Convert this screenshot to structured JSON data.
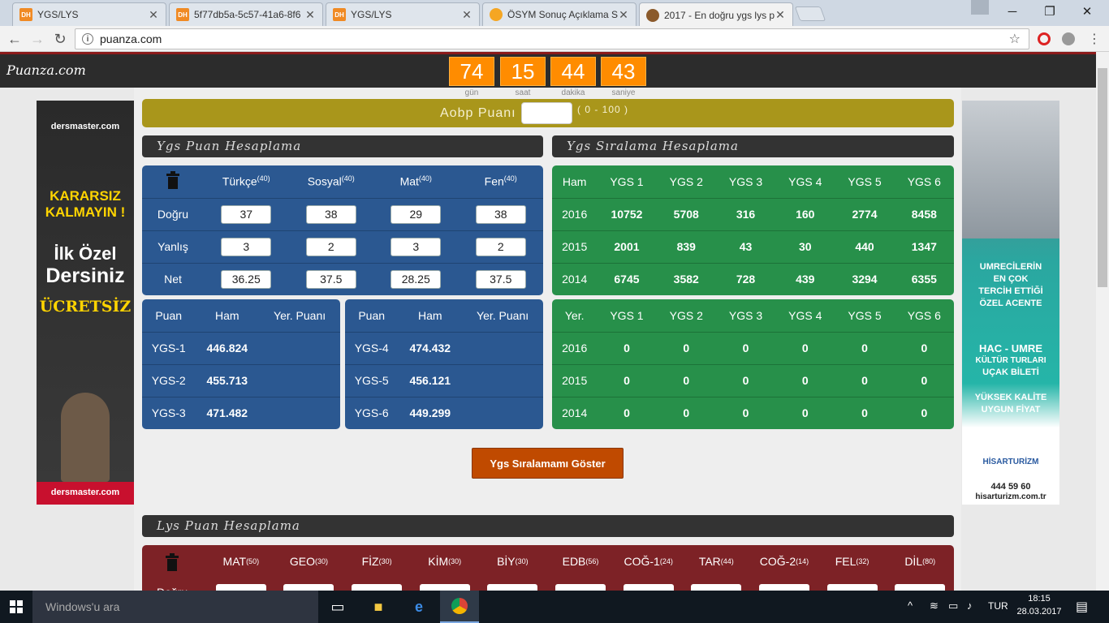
{
  "browser": {
    "tabs": [
      {
        "favicon": "DH",
        "title": "YGS/LYS",
        "color": "#f08a24"
      },
      {
        "favicon": "DH",
        "title": "5f77db5a-5c57-41a6-8f6",
        "color": "#f08a24"
      },
      {
        "favicon": "DH",
        "title": "YGS/LYS",
        "color": "#f08a24"
      },
      {
        "favicon": "",
        "title": "ÖSYM Sonuç Açıklama S",
        "color": "#f5a623"
      },
      {
        "favicon": "",
        "title": "2017 - En doğru ygs lys p",
        "color": "#8b5a2b"
      }
    ],
    "url": "puanza.com"
  },
  "site": {
    "logo": "Puanza.com",
    "countdown": [
      {
        "value": "74",
        "label": "gün"
      },
      {
        "value": "15",
        "label": "saat"
      },
      {
        "value": "44",
        "label": "dakika"
      },
      {
        "value": "43",
        "label": "saniye"
      }
    ],
    "aobp": {
      "label": "Aobp Puanı",
      "value": "",
      "range": "( 0 - 100 )"
    },
    "ygs_header": "Ygs Puan Hesaplama",
    "sira_header": "Ygs Sıralama Hesaplama",
    "lys_header": "Lys Puan Hesaplama",
    "subjects": [
      {
        "name": "Türkçe",
        "max": "(40)",
        "dogru": "37",
        "yanlis": "3",
        "net": "36.25"
      },
      {
        "name": "Sosyal",
        "max": "(40)",
        "dogru": "38",
        "yanlis": "2",
        "net": "37.5"
      },
      {
        "name": "Mat",
        "max": "(40)",
        "dogru": "29",
        "yanlis": "3",
        "net": "28.25"
      },
      {
        "name": "Fen",
        "max": "(40)",
        "dogru": "38",
        "yanlis": "2",
        "net": "37.5"
      }
    ],
    "row_labels": {
      "dogru": "Doğru",
      "yanlis": "Yanlış",
      "net": "Net"
    },
    "score_headers": {
      "puan": "Puan",
      "ham": "Ham",
      "yer": "Yer. Puanı"
    },
    "scores_left": [
      {
        "type": "YGS-1",
        "ham": "446.824",
        "yer": ""
      },
      {
        "type": "YGS-2",
        "ham": "455.713",
        "yer": ""
      },
      {
        "type": "YGS-3",
        "ham": "471.482",
        "yer": ""
      }
    ],
    "scores_right": [
      {
        "type": "YGS-4",
        "ham": "474.432",
        "yer": ""
      },
      {
        "type": "YGS-5",
        "ham": "456.121",
        "yer": ""
      },
      {
        "type": "YGS-6",
        "ham": "449.299",
        "yer": ""
      }
    ],
    "rank_ham": {
      "header": [
        "Ham",
        "YGS 1",
        "YGS 2",
        "YGS 3",
        "YGS 4",
        "YGS 5",
        "YGS 6"
      ],
      "rows": [
        [
          "2016",
          "10752",
          "5708",
          "316",
          "160",
          "2774",
          "8458"
        ],
        [
          "2015",
          "2001",
          "839",
          "43",
          "30",
          "440",
          "1347"
        ],
        [
          "2014",
          "6745",
          "3582",
          "728",
          "439",
          "3294",
          "6355"
        ]
      ]
    },
    "rank_yer": {
      "header": [
        "Yer.",
        "YGS 1",
        "YGS 2",
        "YGS 3",
        "YGS 4",
        "YGS 5",
        "YGS 6"
      ],
      "rows": [
        [
          "2016",
          "0",
          "0",
          "0",
          "0",
          "0",
          "0"
        ],
        [
          "2015",
          "0",
          "0",
          "0",
          "0",
          "0",
          "0"
        ],
        [
          "2014",
          "0",
          "0",
          "0",
          "0",
          "0",
          "0"
        ]
      ]
    },
    "rank_button": "Ygs Sıralamamı Göster",
    "lys_subjects": [
      {
        "name": "MAT",
        "max": "(50)"
      },
      {
        "name": "GEO",
        "max": "(30)"
      },
      {
        "name": "FİZ",
        "max": "(30)"
      },
      {
        "name": "KİM",
        "max": "(30)"
      },
      {
        "name": "BİY",
        "max": "(30)"
      },
      {
        "name": "EDB",
        "max": "(56)"
      },
      {
        "name": "COĞ-1",
        "max": "(24)"
      },
      {
        "name": "TAR",
        "max": "(44)"
      },
      {
        "name": "COĞ-2",
        "max": "(14)"
      },
      {
        "name": "FEL",
        "max": "(32)"
      },
      {
        "name": "DİL",
        "max": "(80)"
      }
    ]
  },
  "ads": {
    "left": {
      "brand": "dersmaster.com",
      "line1": "KARARSIZ",
      "line2": "KALMAYIN !",
      "line3": "İlk Özel",
      "line4": "Dersiniz",
      "line5": "ÜCRETSİZ"
    },
    "right": {
      "line1": "UMRECİLERİN",
      "line2": "EN ÇOK",
      "line3": "TERCİH ETTİĞİ",
      "line4": "ÖZEL ACENTE",
      "line5": "HAC - UMRE",
      "line6": "KÜLTÜR TURLARI",
      "line7": "UÇAK BİLETİ",
      "line8": "YÜKSEK KALİTE",
      "line9": "UYGUN FİYAT",
      "brand": "HİSARTURİZM",
      "phone": "444 59 60",
      "site": "hisarturizm.com.tr"
    }
  },
  "taskbar": {
    "search": "Windows'u ara",
    "lang": "TUR",
    "time": "18:15",
    "date": "28.03.2017"
  }
}
